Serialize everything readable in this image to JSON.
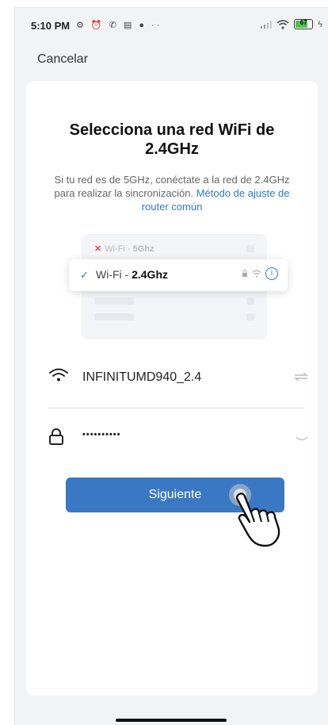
{
  "status_bar": {
    "time": "5:10 PM",
    "notification_icons": "⚙ ⏰ ✆ ▤ ● ··",
    "battery_level": "67",
    "battery_fraction": 0.67
  },
  "nav": {
    "cancel_label": "Cancelar"
  },
  "title": "Selecciona una red WiFi de 2.4GHz",
  "description": "Si tu red es de 5GHz, conéctate a la red de 2.4GHz para realizar la sincronización. ",
  "description_link": "Método de ajuste de router común",
  "illustration": {
    "wifi_5g_prefix": "Wi-Fi - ",
    "wifi_5g_band": "5Ghz",
    "wifi_24g_prefix": "Wi-Fi - ",
    "wifi_24g_band": "2.4Ghz"
  },
  "form": {
    "ssid_value": "INFINITUMD940_2.4",
    "password_mask": "••••••••••",
    "next_label": "Siguiente"
  },
  "colors": {
    "accent": "#3a78c3",
    "link": "#2f78c4",
    "error": "#e24a4a"
  }
}
